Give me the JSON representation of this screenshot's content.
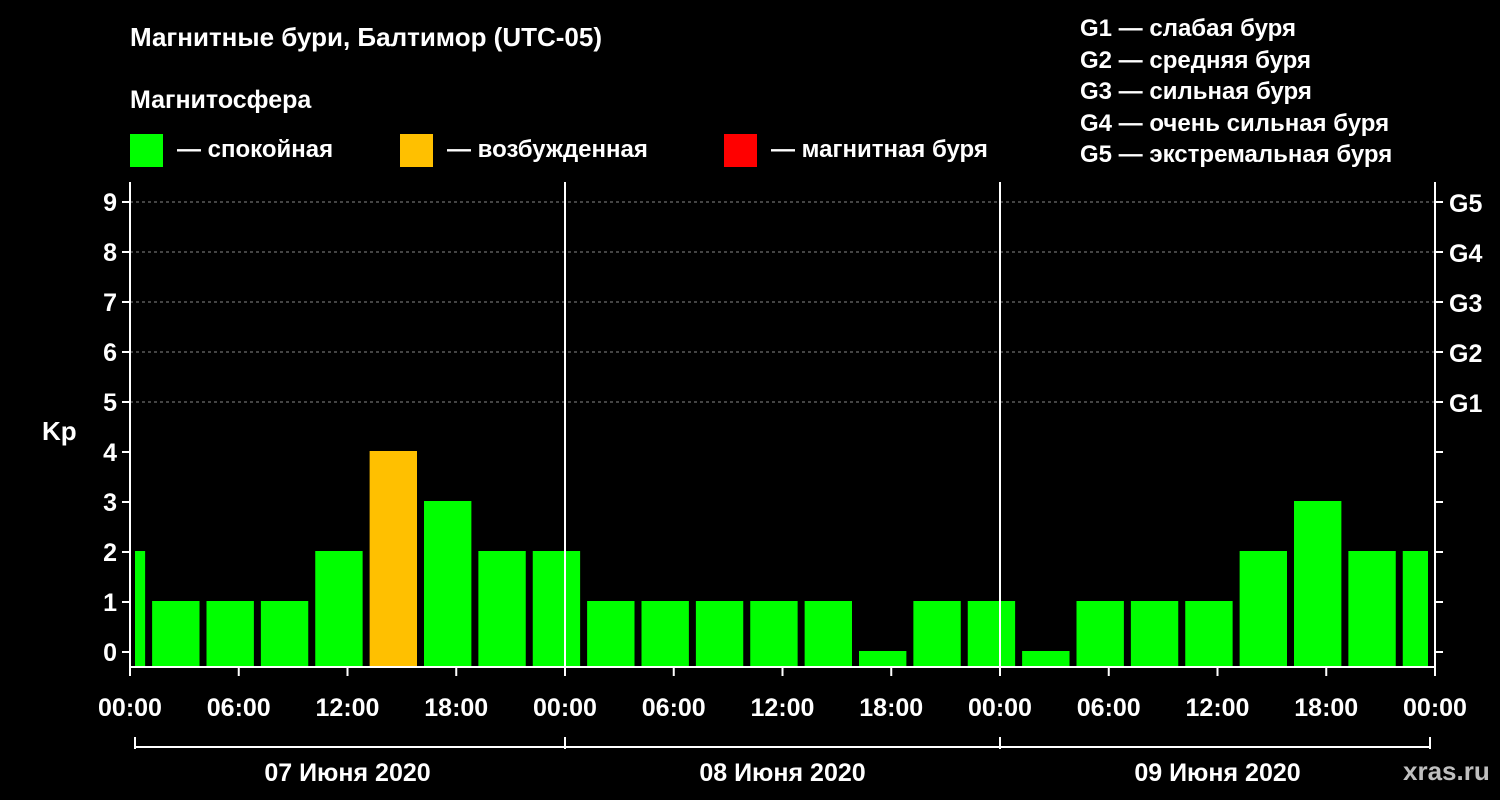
{
  "title": "Магнитные бури, Балтимор (UTC-05)",
  "magnetosphere_label": "Магнитосфера",
  "legend": [
    {
      "label": "— спокойная",
      "color": "#00ff00"
    },
    {
      "label": "— возбужденная",
      "color": "#ffc000"
    },
    {
      "label": "— магнитная буря",
      "color": "#ff0000"
    }
  ],
  "g_scale": [
    "G1 — слабая буря",
    "G2 — средняя буря",
    "G3 — сильная буря",
    "G4 — очень сильная буря",
    "G5 — экстремальная буря"
  ],
  "watermark": "xras.ru",
  "chart_data": {
    "type": "bar",
    "ylabel": "Kp",
    "ylim": [
      0,
      9
    ],
    "yticks": [
      "0",
      "1",
      "2",
      "3",
      "4",
      "5",
      "6",
      "7",
      "8",
      "9"
    ],
    "right_ticks": [
      {
        "kp": 5,
        "label": "G1"
      },
      {
        "kp": 6,
        "label": "G2"
      },
      {
        "kp": 7,
        "label": "G3"
      },
      {
        "kp": 8,
        "label": "G4"
      },
      {
        "kp": 9,
        "label": "G5"
      }
    ],
    "grid": "dashed at Kp 5-9",
    "xtick_labels": [
      "00:00",
      "06:00",
      "12:00",
      "18:00",
      "00:00",
      "06:00",
      "12:00",
      "18:00",
      "00:00",
      "06:00",
      "12:00",
      "18:00",
      "00:00"
    ],
    "days": [
      "07 Июня 2020",
      "08 Июня 2020",
      "09 Июня 2020"
    ],
    "colors": {
      "quiet": "#00ff00",
      "active": "#ffc000",
      "storm": "#ff0000"
    },
    "bars": [
      {
        "start_hour": 0,
        "end_hour": 1,
        "kp": 2,
        "level": "quiet"
      },
      {
        "start_hour": 1,
        "end_hour": 4,
        "kp": 1,
        "level": "quiet"
      },
      {
        "start_hour": 4,
        "end_hour": 7,
        "kp": 1,
        "level": "quiet"
      },
      {
        "start_hour": 7,
        "end_hour": 10,
        "kp": 1,
        "level": "quiet"
      },
      {
        "start_hour": 10,
        "end_hour": 13,
        "kp": 2,
        "level": "quiet"
      },
      {
        "start_hour": 13,
        "end_hour": 16,
        "kp": 4,
        "level": "active"
      },
      {
        "start_hour": 16,
        "end_hour": 19,
        "kp": 3,
        "level": "quiet"
      },
      {
        "start_hour": 19,
        "end_hour": 22,
        "kp": 2,
        "level": "quiet"
      },
      {
        "start_hour": 22,
        "end_hour": 25,
        "kp": 2,
        "level": "quiet"
      },
      {
        "start_hour": 25,
        "end_hour": 28,
        "kp": 1,
        "level": "quiet"
      },
      {
        "start_hour": 28,
        "end_hour": 31,
        "kp": 1,
        "level": "quiet"
      },
      {
        "start_hour": 31,
        "end_hour": 34,
        "kp": 1,
        "level": "quiet"
      },
      {
        "start_hour": 34,
        "end_hour": 37,
        "kp": 1,
        "level": "quiet"
      },
      {
        "start_hour": 37,
        "end_hour": 40,
        "kp": 1,
        "level": "quiet"
      },
      {
        "start_hour": 40,
        "end_hour": 43,
        "kp": 0,
        "level": "quiet"
      },
      {
        "start_hour": 43,
        "end_hour": 46,
        "kp": 1,
        "level": "quiet"
      },
      {
        "start_hour": 46,
        "end_hour": 49,
        "kp": 1,
        "level": "quiet"
      },
      {
        "start_hour": 49,
        "end_hour": 52,
        "kp": 0,
        "level": "quiet"
      },
      {
        "start_hour": 52,
        "end_hour": 55,
        "kp": 1,
        "level": "quiet"
      },
      {
        "start_hour": 55,
        "end_hour": 58,
        "kp": 1,
        "level": "quiet"
      },
      {
        "start_hour": 58,
        "end_hour": 61,
        "kp": 1,
        "level": "quiet"
      },
      {
        "start_hour": 61,
        "end_hour": 64,
        "kp": 2,
        "level": "quiet"
      },
      {
        "start_hour": 64,
        "end_hour": 67,
        "kp": 3,
        "level": "quiet"
      },
      {
        "start_hour": 67,
        "end_hour": 70,
        "kp": 2,
        "level": "quiet"
      },
      {
        "start_hour": 70,
        "end_hour": 72,
        "kp": 2,
        "level": "quiet"
      }
    ]
  }
}
